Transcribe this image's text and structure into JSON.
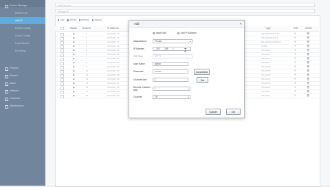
{
  "sidebar": {
    "items": [
      {
        "label": "Device Manager",
        "level": 0,
        "active": false,
        "icon": "device-icon"
      },
      {
        "label": "Device List",
        "level": 1,
        "active": false
      },
      {
        "label": "Add IP",
        "level": 1,
        "active": true
      },
      {
        "label": "Device Config",
        "level": 1,
        "active": false
      },
      {
        "label": "Group Config",
        "level": 1,
        "active": false
      },
      {
        "label": "Local Device",
        "level": 1,
        "active": false
      },
      {
        "label": "Encoding",
        "level": 1,
        "active": false
      },
      {
        "label": "Preview",
        "level": 0,
        "active": false,
        "icon": "preview-icon"
      },
      {
        "label": "Record",
        "level": 0,
        "active": false,
        "icon": "record-icon"
      },
      {
        "label": "Alarm",
        "level": 0,
        "active": false,
        "icon": "alarm-icon"
      },
      {
        "label": "Network",
        "level": 0,
        "active": false,
        "icon": "network-icon"
      },
      {
        "label": "Channels",
        "level": 0,
        "active": false,
        "icon": "channels-icon"
      },
      {
        "label": "Maintenance",
        "level": 0,
        "active": false,
        "icon": "maintenance-icon"
      }
    ]
  },
  "top_bars": [
    "Add Camera",
    "Manage IP"
  ],
  "toolbar": {
    "items": [
      {
        "label": "Add",
        "icon": "plus-icon"
      },
      {
        "label": "Delete",
        "icon": "delete-icon"
      },
      {
        "label": "Refresh",
        "icon": "refresh-icon"
      },
      {
        "label": "Search",
        "icon": "search-icon"
      }
    ]
  },
  "table": {
    "headers": [
      "",
      "Status",
      "Channel",
      "IP Address",
      "Type",
      "Edit",
      "Delete"
    ],
    "rows": [
      {
        "channel": "1",
        "ip": "192.168.1.75",
        "type": "IPC-HDW2231T-AS"
      },
      {
        "channel": "2",
        "ip": "192.168.1.76",
        "type": "IPC-HFW2431S-S"
      },
      {
        "channel": "3",
        "ip": "192.168.1.77",
        "type": "DS-2CD2142FWD-IS"
      },
      {
        "channel": "4",
        "ip": "192.168.1.78",
        "type": "ONVIF"
      },
      {
        "channel": "5",
        "ip": "192.168.1.79",
        "type": "IPC-HDW"
      },
      {
        "channel": "6",
        "ip": "192.168.1.80",
        "type": "IPC-HDW"
      },
      {
        "channel": "7",
        "ip": "192.168.1.81",
        "type": "IPC-HDW"
      },
      {
        "channel": "8",
        "ip": "192.168.1.82",
        "type": "IPC-HDW"
      },
      {
        "channel": "9",
        "ip": "192.168.1.83",
        "type": "IPC-HDW"
      },
      {
        "channel": "10",
        "ip": "192.168.1.84",
        "type": "IPC-HDW"
      },
      {
        "channel": "11",
        "ip": "192.168.1.85",
        "type": "IPC-HDW"
      },
      {
        "channel": "12",
        "ip": "192.168.1.86",
        "type": "IPC-HDW"
      },
      {
        "channel": "13",
        "ip": "192.168.1.87",
        "type": "IPC-HDW"
      },
      {
        "channel": "14",
        "ip": "192.168.1.88",
        "type": "IPC-HDW"
      },
      {
        "channel": "15",
        "ip": "192.168.1.89",
        "type": "IPC-HDW"
      },
      {
        "channel": "16",
        "ip": "192.168.1.90",
        "type": "IPC-HDW"
      }
    ]
  },
  "dialog": {
    "title": "Add",
    "radio_batch": "Batch Add",
    "radio_add_ip": "Add IP Address",
    "selected_radio": "add_ip",
    "fields": {
      "manufacturer": {
        "label": "Manufacturer",
        "value": "Private"
      },
      "ip_address": {
        "label": "IP Address",
        "octets": [
          "192",
          "168",
          "1",
          ""
        ]
      },
      "tcp_port": {
        "label": "TCP Port",
        "value": "37777"
      },
      "user_name": {
        "label": "User Name",
        "value": "admin"
      },
      "password": {
        "label": "Password",
        "value": "••••••••"
      },
      "channel_max": {
        "label": "Channel Max",
        "value": "1"
      },
      "remote_channel_max": {
        "label": "Remote Channel Max",
        "value": "1"
      },
      "channel": {
        "label": "Channel",
        "value": "16"
      }
    },
    "connected_label": "Connected",
    "set_label": "Set",
    "cancel_label": "Cancel",
    "ok_label": "OK"
  }
}
